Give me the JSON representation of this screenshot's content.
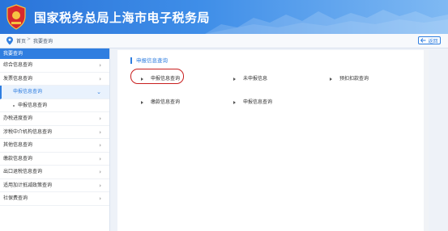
{
  "header": {
    "title": "国家税务总局上海市电子税务局"
  },
  "breadcrumb": {
    "home": "首页",
    "separator": ">",
    "current": "我要查询"
  },
  "back_button": {
    "label": "返回"
  },
  "sidebar": {
    "heading": "我要查询",
    "items": [
      {
        "label": "综合信息查询",
        "chev": "›"
      },
      {
        "label": "发票信息查询",
        "chev": "›"
      },
      {
        "label": "申报信息查询",
        "chev": "⌄",
        "active": true
      },
      {
        "label": "申报信息查询",
        "sub": true
      },
      {
        "label": "办税进度查询",
        "chev": "›"
      },
      {
        "label": "涉税中介机构信息查询",
        "chev": "›"
      },
      {
        "label": "其他信息查询",
        "chev": "›"
      },
      {
        "label": "缴款信息查询",
        "chev": "›"
      },
      {
        "label": "出口退税信息查询",
        "chev": "›"
      },
      {
        "label": "适用加计抵减政策查询",
        "chev": "›"
      },
      {
        "label": "社保费查询",
        "chev": "›"
      }
    ]
  },
  "main": {
    "section_title": "申报信息查询",
    "links": [
      "申报信息查询",
      "未申报信息",
      "预扣扣款查询",
      "缴款信息查询",
      "申报信息查询"
    ]
  },
  "colors": {
    "accent": "#2f7ee0",
    "highlight_ring": "#c81e1e"
  }
}
